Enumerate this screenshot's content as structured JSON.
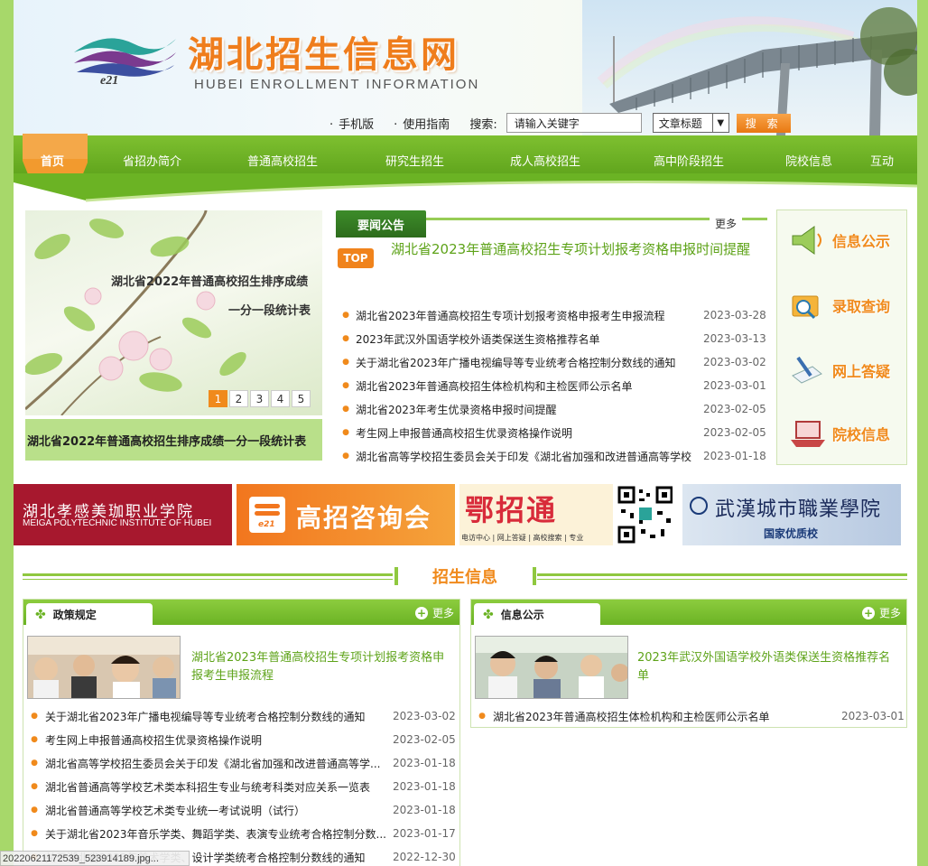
{
  "header": {
    "site_title": "湖北招生信息网",
    "site_subtitle": "HUBEI ENROLLMENT INFORMATION",
    "logo_text": "e21",
    "links": [
      "手机版",
      "使用指南"
    ],
    "search_label": "搜索:",
    "search_value": "请输入关键字",
    "search_scope": "文章标题",
    "search_button": "搜 索"
  },
  "nav": {
    "items": [
      "首页",
      "省招办简介",
      "普通高校招生",
      "研究生招生",
      "成人高校招生",
      "高中阶段招生",
      "院校信息",
      "互动"
    ]
  },
  "slideshow": {
    "line1": "湖北省2022年普通高校招生排序成绩",
    "line2": "一分一段统计表",
    "pages": [
      "1",
      "2",
      "3",
      "4",
      "5"
    ],
    "caption": "湖北省2022年普通高校招生排序成绩一分一段统计表"
  },
  "news": {
    "tab": "要闻公告",
    "more": "更多",
    "top_badge": "TOP",
    "headline": "湖北省2023年普通高校招生专项计划报考资格申报时间提醒",
    "items": [
      {
        "title": "湖北省2023年普通高校招生专项计划报考资格申报考生申报流程",
        "date": "2023-03-28"
      },
      {
        "title": "2023年武汉外国语学校外语类保送生资格推荐名单",
        "date": "2023-03-13"
      },
      {
        "title": "关于湖北省2023年广播电视编导等专业统考合格控制分数线的通知",
        "date": "2023-03-02"
      },
      {
        "title": "湖北省2023年普通高校招生体检机构和主检医师公示名单",
        "date": "2023-03-01"
      },
      {
        "title": "湖北省2023年考生优录资格申报时间提醒",
        "date": "2023-02-05"
      },
      {
        "title": "考生网上申报普通高校招生优录资格操作说明",
        "date": "2023-02-05"
      },
      {
        "title": "湖北省高等学校招生委员会关于印发《湖北省加强和改进普通高等学校",
        "date": "2023-01-18"
      }
    ]
  },
  "quick": {
    "items": [
      "信息公示",
      "录取查询",
      "网上答疑",
      "院校信息"
    ]
  },
  "banners": {
    "b1_cn": "湖北孝感美珈职业学院",
    "b1_en": "MEIGA POLYTECHNIC INSTITUTE OF HUBEI",
    "b2_logo": "e21",
    "b2_text": "高招咨询会",
    "b3_text": "鄂招通",
    "b3_sub": "电访中心 | 网上答疑 | 高校搜索 | 专业",
    "b4_text": "武漢城市職業學院",
    "b4_sub": "国家优质校"
  },
  "section": {
    "title": "招生信息"
  },
  "policy": {
    "tab": "政策规定",
    "more": "更多",
    "feature": "湖北省2023年普通高校招生专项计划报考资格申报考生申报流程",
    "items": [
      {
        "title": "关于湖北省2023年广播电视编导等专业统考合格控制分数线的通知",
        "date": "2023-03-02"
      },
      {
        "title": "考生网上申报普通高校招生优录资格操作说明",
        "date": "2023-02-05"
      },
      {
        "title": "湖北省高等学校招生委员会关于印发《湖北省加强和改进普通高等学...",
        "date": "2023-01-18"
      },
      {
        "title": "湖北省普通高等学校艺术类本科招生专业与统考科类对应关系一览表",
        "date": "2023-01-18"
      },
      {
        "title": "湖北省普通高等学校艺术类专业统一考试说明（试行）",
        "date": "2023-01-18"
      },
      {
        "title": "关于湖北省2023年音乐学类、舞蹈学类、表演专业统考合格控制分数...",
        "date": "2023-01-17"
      },
      {
        "title": "关于湖北省2023年美术学类、设计学类统考合格控制分数线的通知",
        "date": "2022-12-30"
      }
    ]
  },
  "publicity": {
    "tab": "信息公示",
    "more": "更多",
    "feature": "2023年武汉外国语学校外语类保送生资格推荐名单",
    "items": [
      {
        "title": "湖北省2023年普通高校招生体检机构和主检医师公示名单",
        "date": "2023-03-01"
      }
    ]
  },
  "status_bar": "20220621172539_523914189.jpg..."
}
